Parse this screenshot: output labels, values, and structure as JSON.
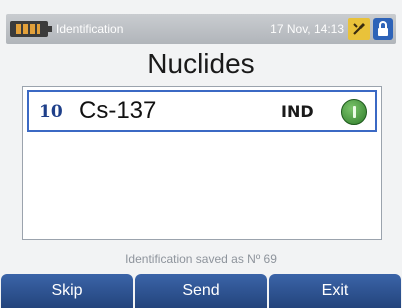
{
  "status": {
    "battery_icon": "battery-icon",
    "title": "Identification",
    "datetime": "17 Nov, 14:13",
    "tool_icon": "tool-icon",
    "lock_icon": "lock-icon"
  },
  "page": {
    "title": "Nuclides"
  },
  "list": {
    "rows": [
      {
        "index": "10",
        "nuclide": "Cs-137",
        "type": "IND",
        "info_icon": "info-icon"
      }
    ]
  },
  "message": "Identification saved as Nº 69",
  "softkeys": {
    "skip": "Skip",
    "send": "Send",
    "exit": "Exit"
  },
  "colors": {
    "selection": "#3b69c4",
    "softkey": "#2d5393",
    "info": "#3f9a38"
  }
}
